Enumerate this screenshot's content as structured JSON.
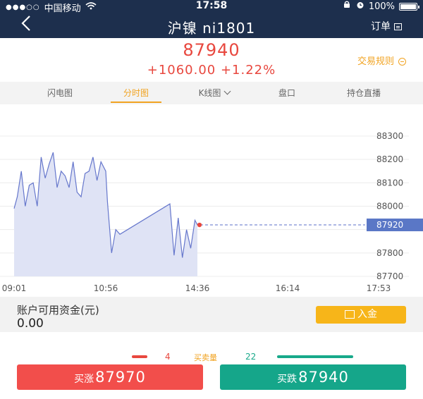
{
  "status_bar": {
    "signal": "●●●○○",
    "carrier": "中国移动",
    "time": "17:58",
    "battery": "100%"
  },
  "nav": {
    "back_icon": "chevron-left-icon",
    "title": "沪镍 ni1801",
    "order_label": "订单"
  },
  "quote": {
    "price": "87940",
    "change": "+1060.00 +1.22%",
    "rules_label": "交易规则",
    "color_up": "#e8473e"
  },
  "tabs": [
    {
      "label": "闪电图",
      "active": false
    },
    {
      "label": "分时图",
      "active": true
    },
    {
      "label": "K线图",
      "active": false
    },
    {
      "label": "盘口",
      "active": false
    },
    {
      "label": "持仓直播",
      "active": false
    }
  ],
  "chart_data": {
    "type": "area",
    "y_ticks": [
      "88300",
      "88200",
      "88100",
      "88000",
      "87920",
      "87800",
      "87700"
    ],
    "x_ticks": [
      "09:01",
      "10:56",
      "14:36",
      "16:14",
      "17:53"
    ],
    "ylim": [
      87700,
      88300
    ],
    "current_price": "87920",
    "series": [
      {
        "x": [
          "09:01",
          "09:05",
          "09:10",
          "09:15",
          "09:20",
          "09:25",
          "09:30",
          "09:35",
          "09:40",
          "09:45",
          "09:50",
          "09:55",
          "10:00",
          "10:05",
          "10:10",
          "10:15",
          "10:20",
          "10:25",
          "10:30",
          "10:35",
          "10:40",
          "10:45",
          "10:50",
          "10:56",
          "11:00",
          "11:10",
          "11:20",
          "11:30",
          "13:30",
          "13:40",
          "13:50",
          "14:00",
          "14:10",
          "14:20",
          "14:30",
          "14:36"
        ],
        "values": [
          87990,
          88040,
          88150,
          88000,
          88090,
          88100,
          88000,
          88210,
          88120,
          88180,
          88230,
          88080,
          88150,
          88130,
          88080,
          88190,
          88060,
          88040,
          88140,
          88150,
          88210,
          88110,
          88190,
          88150,
          88020,
          87800,
          87900,
          87880,
          88010,
          87790,
          87950,
          87780,
          87900,
          87820,
          87940,
          87920
        ]
      }
    ],
    "line_color": "#6677cc",
    "fill_color": "#dfe3f5",
    "grid": true
  },
  "account": {
    "label": "账户可用资金(元)",
    "value": "0.00",
    "deposit_label": "入金"
  },
  "volume": {
    "buy_count": "4",
    "label": "买卖量",
    "sell_count": "22"
  },
  "actions": {
    "buy_up_label": "买涨",
    "buy_up_price": "87970",
    "buy_down_label": "买跌",
    "buy_down_price": "87940"
  }
}
